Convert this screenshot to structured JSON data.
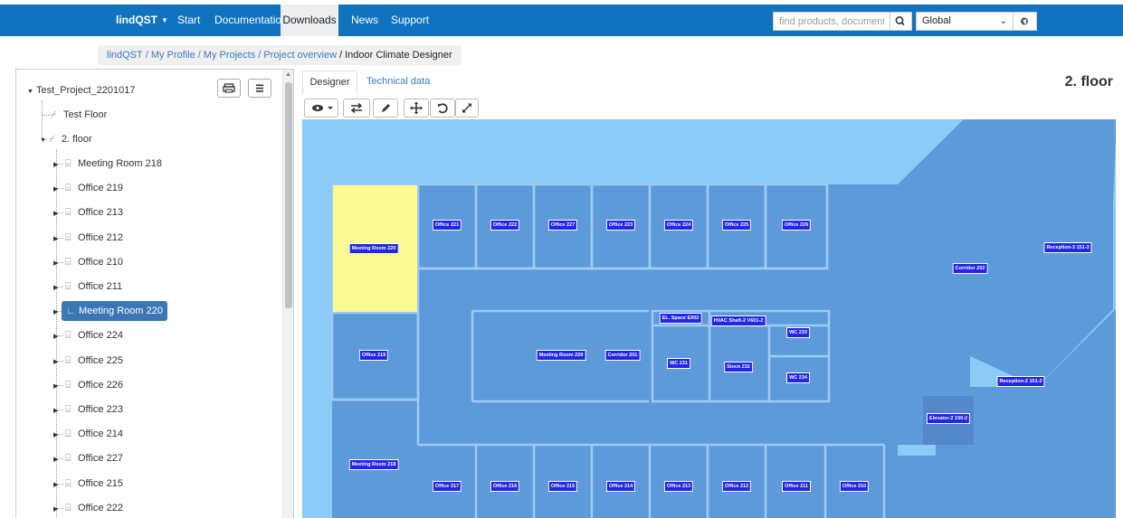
{
  "nav": {
    "brand": "lindQST",
    "items": [
      "Start",
      "Documentation",
      "Downloads",
      "News",
      "Support"
    ],
    "active": "Downloads",
    "search_placeholder": "find products, documents etc",
    "region": "Global"
  },
  "breadcrumb": {
    "links": [
      "lindQST",
      "My Profile",
      "My Projects",
      "Project overview"
    ],
    "current": "Indoor Climate Designer"
  },
  "tree": {
    "project": "Test_Project_2201017",
    "floors": [
      "Test Floor",
      "2. floor"
    ],
    "rooms": [
      "Meeting Room 218",
      "Office 219",
      "Office 213",
      "Office 212",
      "Office 210",
      "Office 211",
      "Meeting Room 220",
      "Office 224",
      "Office 225",
      "Office 226",
      "Office 223",
      "Office 214",
      "Office 227",
      "Office 215",
      "Office 222"
    ],
    "selected": "Meeting Room 220"
  },
  "tabs": {
    "designer": "Designer",
    "technical": "Technical data"
  },
  "floor_title": "2. floor",
  "colors": {
    "nav": "#0f73c0",
    "outside": "#8ccaf7",
    "room": "#5d9ad9",
    "room_dark": "#5488c9",
    "wall": "#9dccf2",
    "selected_room": "#fbf994",
    "label_bg": "#2226e8",
    "tree_selected": "#3a77b4"
  },
  "designer": {
    "labels": {
      "r221": "Office 221",
      "r222": "Office 222",
      "r227": "Office 227",
      "r223": "Office 223",
      "r224": "Office 224",
      "r225": "Office 225",
      "r226": "Office 226",
      "mr220": "Meeting Room 220",
      "r219": "Office 219",
      "mr228": "Meeting Room 228",
      "corr201": "Corridor 201",
      "elspace": "EL. Space E002",
      "hvac": "HVAC Shaft-2 V601-2",
      "wc233": "WC 233",
      "wc231": "WC 231",
      "stock232": "Stock 232",
      "wc234": "WC 234",
      "mr218": "Meeting Room 218",
      "r217": "Office 217",
      "r216": "Office 216",
      "r215": "Office 215",
      "r214": "Office 214",
      "r213": "Office 213",
      "r212": "Office 212",
      "r211": "Office 211",
      "r210": "Office 210",
      "corr202": "Corridor 202",
      "rec3": "Reception-3 151-3",
      "rec2": "Reception-2 151-2",
      "elev2": "Elevator-2 150-2"
    }
  }
}
